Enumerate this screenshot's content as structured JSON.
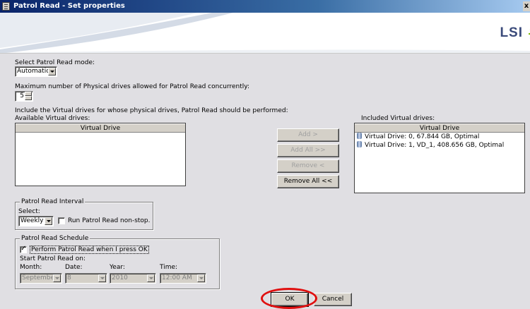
{
  "window": {
    "title": "Patrol Read - Set properties",
    "close_glyph": "x"
  },
  "brand": {
    "logo_text": "LSI"
  },
  "mode": {
    "label": "Select Patrol Read mode:",
    "value": "Automatic"
  },
  "max_drives": {
    "label": "Maximum number of Physical drives allowed for Patrol Read concurrently:",
    "value": "5"
  },
  "include_label": "Include the Virtual drives for whose physical drives, Patrol Read should be performed:",
  "available": {
    "label": "Available Virtual drives:",
    "column": "Virtual Drive"
  },
  "included": {
    "label": "Included Virtual drives:",
    "column": "Virtual Drive",
    "rows": [
      "Virtual Drive: 0, 67.844 GB, Optimal",
      "Virtual Drive: 1, VD_1, 408.656 GB, Optimal"
    ]
  },
  "transfer": {
    "add": "Add >",
    "add_all": "Add All >>",
    "remove": "Remove <",
    "remove_all": "Remove All <<"
  },
  "interval": {
    "legend": "Patrol Read Interval",
    "select_label": "Select:",
    "value": "Weekly",
    "nonstop_label": "Run Patrol Read non-stop."
  },
  "schedule": {
    "legend": "Patrol Read Schedule",
    "perform_label": "Perform Patrol Read when I press OK",
    "start_label": "Start Patrol Read on:",
    "month_label": "Month:",
    "month_value": "September",
    "date_label": "Date:",
    "date_value": "8",
    "year_label": "Year:",
    "year_value": "2010",
    "time_label": "Time:",
    "time_value": "12:00 AM"
  },
  "footer": {
    "ok": "OK",
    "cancel": "Cancel"
  },
  "colors": {
    "highlight": "#e01010",
    "titlebar": "#0a246a"
  }
}
